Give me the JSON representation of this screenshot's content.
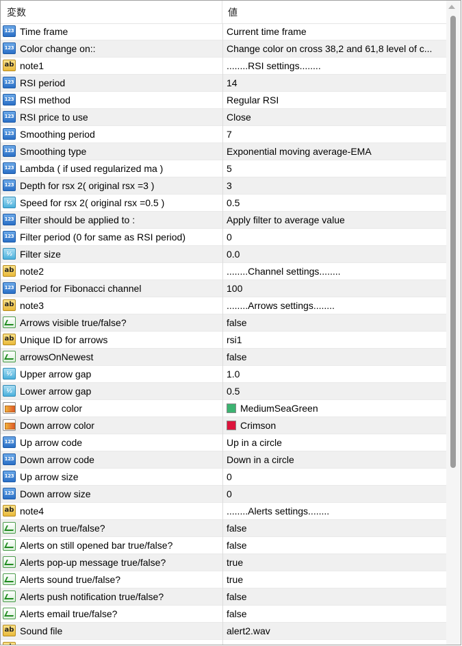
{
  "header": {
    "name_col": "変数",
    "value_col": "値"
  },
  "rows": [
    {
      "icon": "int",
      "name": "Time frame",
      "value": "Current time frame"
    },
    {
      "icon": "int",
      "name": "Color change on::",
      "value": "Change color on cross 38,2 and 61,8 level of c..."
    },
    {
      "icon": "str",
      "name": "note1",
      "value": "........RSI settings........"
    },
    {
      "icon": "int",
      "name": "RSI period",
      "value": "14"
    },
    {
      "icon": "int",
      "name": "RSI method",
      "value": "Regular RSI"
    },
    {
      "icon": "int",
      "name": "RSI price to use",
      "value": "Close"
    },
    {
      "icon": "int",
      "name": "Smoothing period",
      "value": "7"
    },
    {
      "icon": "int",
      "name": "Smoothing type",
      "value": "Exponential moving average-EMA"
    },
    {
      "icon": "int",
      "name": "Lambda ( if used regularized ma )",
      "value": "5"
    },
    {
      "icon": "int",
      "name": "Depth for rsx 2( original rsx =3 )",
      "value": "3"
    },
    {
      "icon": "dbl",
      "name": "Speed for rsx 2( original rsx =0.5 )",
      "value": "0.5"
    },
    {
      "icon": "int",
      "name": "Filter should be applied to :",
      "value": "Apply filter to average value"
    },
    {
      "icon": "int",
      "name": "Filter period (0 for same as RSI period)",
      "value": "0"
    },
    {
      "icon": "dbl",
      "name": "Filter size",
      "value": "0.0"
    },
    {
      "icon": "str",
      "name": "note2",
      "value": "........Channel settings........"
    },
    {
      "icon": "int",
      "name": "Period for Fibonacci channel",
      "value": "100"
    },
    {
      "icon": "str",
      "name": "note3",
      "value": "........Arrows settings........"
    },
    {
      "icon": "bool",
      "name": "Arrows visible true/false?",
      "value": "false"
    },
    {
      "icon": "str",
      "name": "Unique ID for arrows",
      "value": "rsi1"
    },
    {
      "icon": "bool",
      "name": "arrowsOnNewest",
      "value": "false"
    },
    {
      "icon": "dbl",
      "name": "Upper arrow gap",
      "value": "1.0"
    },
    {
      "icon": "dbl",
      "name": "Lower arrow gap",
      "value": "0.5"
    },
    {
      "icon": "clr",
      "name": "Up arrow color",
      "value": "MediumSeaGreen",
      "swatch": "#3cb371"
    },
    {
      "icon": "clr",
      "name": "Down arrow color",
      "value": "Crimson",
      "swatch": "#dc143c"
    },
    {
      "icon": "int",
      "name": "Up arrow code",
      "value": "Up in a circle"
    },
    {
      "icon": "int",
      "name": "Down arrow code",
      "value": "Down in a circle"
    },
    {
      "icon": "int",
      "name": "Up arrow size",
      "value": "0"
    },
    {
      "icon": "int",
      "name": "Down arrow size",
      "value": "0"
    },
    {
      "icon": "str",
      "name": "note4",
      "value": "........Alerts settings........"
    },
    {
      "icon": "bool",
      "name": "Alerts on true/false?",
      "value": "false"
    },
    {
      "icon": "bool",
      "name": "Alerts on still opened bar true/false?",
      "value": "false"
    },
    {
      "icon": "bool",
      "name": "Alerts pop-up message true/false?",
      "value": "true"
    },
    {
      "icon": "bool",
      "name": "Alerts sound true/false?",
      "value": "true"
    },
    {
      "icon": "bool",
      "name": "Alerts push notification true/false?",
      "value": "false"
    },
    {
      "icon": "bool",
      "name": "Alerts email true/false?",
      "value": "false"
    },
    {
      "icon": "str",
      "name": "Sound file",
      "value": "alert2.wav"
    },
    {
      "icon": "str",
      "name": "",
      "value": ""
    }
  ],
  "icon_labels": {
    "int": "123",
    "str": "ab",
    "dbl": "½"
  },
  "icon_names": {
    "int": "integer-type-icon",
    "str": "string-type-icon",
    "dbl": "double-type-icon",
    "bool": "boolean-type-icon",
    "clr": "color-type-icon"
  }
}
